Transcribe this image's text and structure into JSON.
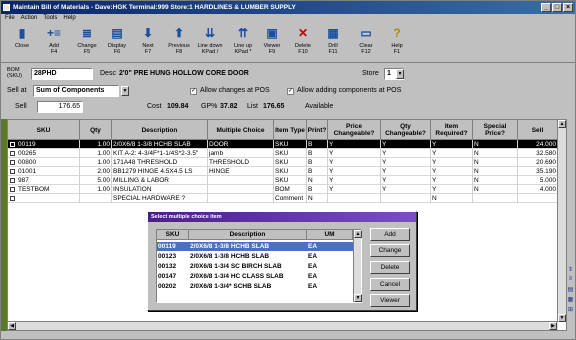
{
  "window": {
    "title": "Maintain Bill of Materials - Dave:HGK Terminal:999 Store:1 HARDLINES & LUMBER SUPPLY",
    "controls": [
      "_",
      "□",
      "×"
    ]
  },
  "menu": [
    "File",
    "Action",
    "Tools",
    "Help"
  ],
  "toolbar": [
    {
      "label": "Close",
      "key": "",
      "icon": "close-door-icon",
      "glyph": "▮"
    },
    {
      "label": "Add",
      "key": "F4",
      "icon": "add-row-icon",
      "glyph": "+≡"
    },
    {
      "label": "Change",
      "key": "F5",
      "icon": "change-icon",
      "glyph": "≣"
    },
    {
      "label": "Display",
      "key": "F6",
      "icon": "display-icon",
      "glyph": "▤"
    },
    {
      "label": "Next",
      "key": "F7",
      "icon": "arrow-down-icon",
      "glyph": "⬇"
    },
    {
      "label": "Previous",
      "key": "F8",
      "icon": "arrow-up-icon",
      "glyph": "⬆"
    },
    {
      "label": "Line down",
      "key": "KPad /",
      "icon": "line-down-icon",
      "glyph": "⇊"
    },
    {
      "label": "Line up",
      "key": "KPad *",
      "icon": "line-up-icon",
      "glyph": "⇈"
    },
    {
      "label": "Viewer",
      "key": "F9",
      "icon": "viewer-icon",
      "glyph": "▣"
    },
    {
      "label": "Delete",
      "key": "F10",
      "icon": "delete-x-icon",
      "glyph": "✕"
    },
    {
      "label": "Drill",
      "key": "F11",
      "icon": "drill-icon",
      "glyph": "▦"
    },
    {
      "label": "Clear",
      "key": "F12",
      "icon": "clear-icon",
      "glyph": "▭"
    },
    {
      "label": "Help",
      "key": "F1",
      "icon": "help-icon",
      "glyph": "?"
    }
  ],
  "header": {
    "bom_label": "BOM (SKU)",
    "bom_value": "28PHD",
    "desc_label": "Desc",
    "desc_value": "2'0\" PRE HUNG HOLLOW CORE DOOR",
    "store_label": "Store",
    "store_value": "1",
    "sell_at_label": "Sell at",
    "sell_at_value": "Sum of Components",
    "allow_changes_label": "Allow changes at POS",
    "allow_adding_label": "Allow adding components at POS",
    "sell_label": "Sell",
    "sell_value": "176.65",
    "cost_label": "Cost",
    "cost_value": "109.84",
    "gp_label": "GP%",
    "gp_value": "37.82",
    "list_label": "List",
    "list_value": "176.65",
    "available_label": "Available"
  },
  "grid": {
    "columns": [
      "SKU",
      "Qty",
      "Description",
      "Multiple Choice",
      "Item Type",
      "Print?",
      "Price Changeable?",
      "Qty Changeable?",
      "Item Required?",
      "Special Price?",
      "Sell"
    ],
    "rows": [
      {
        "sku": "00119",
        "qty": "1.00",
        "desc": "2/0X6/8 1-3/8 HCHB SLAB",
        "mc": "DOOR",
        "type": "SKU",
        "print": "B",
        "pc": "Y",
        "qc": "Y",
        "req": "Y",
        "sp": "N",
        "sell": "24.000",
        "selected": true
      },
      {
        "sku": "00265",
        "qty": "1.00",
        "desc": "KIT A-2: 4-3/4F*1-1/4S*2-3.5\"",
        "mc": "jamb",
        "type": "SKU",
        "print": "B",
        "pc": "Y",
        "qc": "Y",
        "req": "Y",
        "sp": "N",
        "sell": "32.580",
        "selected": false
      },
      {
        "sku": "00800",
        "qty": "1.00",
        "desc": "171A48 THRESHOLD",
        "mc": "THRESHOLD",
        "type": "SKU",
        "print": "B",
        "pc": "Y",
        "qc": "Y",
        "req": "Y",
        "sp": "N",
        "sell": "20.690",
        "selected": false
      },
      {
        "sku": "01001",
        "qty": "2.00",
        "desc": "BB1279 HINGE 4.5X4.5 LS",
        "mc": "HINGE",
        "type": "SKU",
        "print": "B",
        "pc": "Y",
        "qc": "Y",
        "req": "Y",
        "sp": "N",
        "sell": "35.190",
        "selected": false
      },
      {
        "sku": "987",
        "qty": "5.00",
        "desc": "MILLING & LABOR",
        "mc": "",
        "type": "SKU",
        "print": "N",
        "pc": "Y",
        "qc": "Y",
        "req": "Y",
        "sp": "N",
        "sell": "5.000",
        "selected": false
      },
      {
        "sku": "TESTBOM",
        "qty": "1.00",
        "desc": "INSULATION",
        "mc": "",
        "type": "BOM",
        "print": "B",
        "pc": "Y",
        "qc": "Y",
        "req": "Y",
        "sp": "N",
        "sell": "4.000",
        "selected": false
      },
      {
        "sku": "",
        "qty": "",
        "desc": "SPECIAL HARDWARE ?",
        "mc": "",
        "type": "Comment",
        "print": "N",
        "pc": "",
        "qc": "",
        "req": "N",
        "sp": "",
        "sell": "",
        "selected": false
      }
    ]
  },
  "dialog": {
    "title": "Select multiple choice item",
    "columns": [
      "SKU",
      "Description",
      "UM"
    ],
    "rows": [
      {
        "sku": "00119",
        "desc": "2/0X6/8 1-3/8 HCHB SLAB",
        "um": "EA",
        "selected": true
      },
      {
        "sku": "00123",
        "desc": "2/0X6/8 1-3/8 HCHB SLAB",
        "um": "EA",
        "selected": false
      },
      {
        "sku": "00132",
        "desc": "2/0X6/8 1-3/4 SC BIRCH SLAB",
        "um": "EA",
        "selected": false
      },
      {
        "sku": "00147",
        "desc": "2/0X6/8 1-3/4 HC CLASS SLAB",
        "um": "EA",
        "selected": false
      },
      {
        "sku": "00202",
        "desc": "2/0X6/8 1-3/4* SCHB SLAB",
        "um": "EA",
        "selected": false
      }
    ],
    "buttons": [
      "Add",
      "Change",
      "Delete",
      "Cancel",
      "Viewer"
    ]
  },
  "colors": {
    "title_bar": "#0a246a",
    "dialog_title": "#4b1e87",
    "dialog_selection": "#4a6fc4",
    "grid_selection": "#000000"
  }
}
